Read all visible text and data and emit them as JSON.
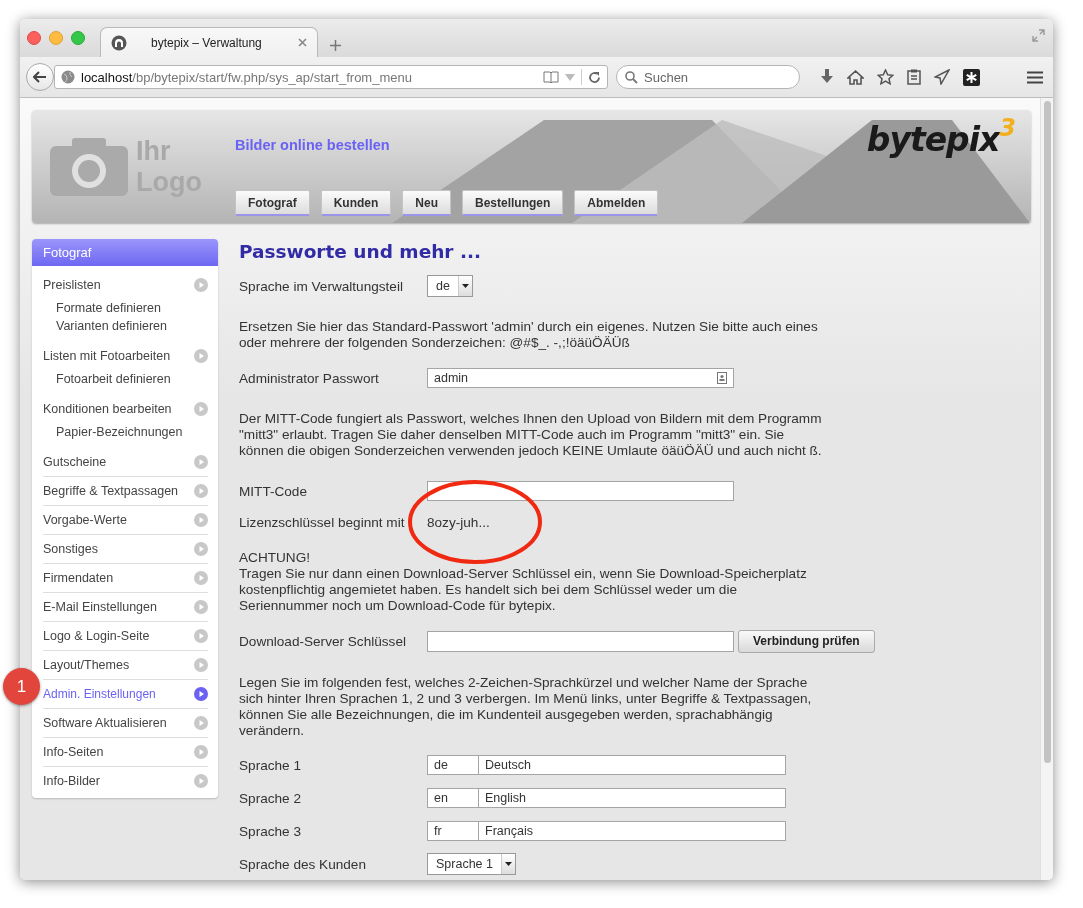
{
  "browser": {
    "tab_title": "bytepix – Verwaltung",
    "url": {
      "host": "localhost",
      "path": "/bp/bytepix/start/fw.php/sys_ap/start_from_menu"
    },
    "search": {
      "placeholder": "Suchen"
    }
  },
  "header": {
    "logo_placeholder": [
      "Ihr",
      "Logo"
    ],
    "tagline": "Bilder online bestellen",
    "nav": [
      "Fotograf",
      "Kunden",
      "Neu",
      "Bestellungen",
      "Abmelden"
    ],
    "brand": {
      "name": "bytepix",
      "version": "3"
    }
  },
  "sidebar": {
    "title": "Fotograf",
    "items": [
      {
        "label": "Preislisten",
        "selected": false,
        "children": [
          "Formate definieren",
          "Varianten definieren"
        ]
      },
      {
        "label": "Listen mit Fotoarbeiten",
        "selected": false,
        "children": [
          "Fotoarbeit definieren"
        ]
      },
      {
        "label": "Konditionen bearbeiten",
        "selected": false,
        "children": [
          "Papier-Bezeichnungen"
        ]
      },
      {
        "label": "Gutscheine",
        "selected": false
      },
      {
        "label": "Begriffe & Textpassagen",
        "selected": false
      },
      {
        "label": "Vorgabe-Werte",
        "selected": false
      },
      {
        "label": "Sonstiges",
        "selected": false
      },
      {
        "label": "Firmendaten",
        "selected": false
      },
      {
        "label": "E-Mail Einstellungen",
        "selected": false
      },
      {
        "label": "Logo & Login-Seite",
        "selected": false
      },
      {
        "label": "Layout/Themes",
        "selected": false
      },
      {
        "label": "Admin. Einstellungen",
        "selected": true
      },
      {
        "label": "Software Aktualisieren",
        "selected": false
      },
      {
        "label": "Info-Seiten",
        "selected": false
      },
      {
        "label": "Info-Bilder",
        "selected": false
      }
    ]
  },
  "annotation": {
    "label": "1"
  },
  "content": {
    "title": "Passworte und mehr ...",
    "rows": [
      {
        "kind": "select",
        "label": "Sprache im Verwaltungsteil",
        "value": "de"
      },
      {
        "kind": "paragraph",
        "text": "Ersetzen Sie hier das Standard-Passwort 'admin' durch ein eigenes. Nutzen Sie bitte auch eines oder mehrere der folgenden Sonderzeichen: @#$_. -,;!öäüÖÄÜß"
      },
      {
        "kind": "password",
        "label": "Administrator Passwort",
        "value": "admin"
      },
      {
        "kind": "paragraph",
        "text": "Der MITT-Code fungiert als Passwort, welches Ihnen den Upload von Bildern mit dem Programm \"mitt3\" erlaubt. Tragen Sie daher denselben MITT-Code auch im Programm \"mitt3\" ein. Sie können die obigen Sonderzeichen verwenden jedoch KEINE Umlaute öäüÖÄÜ und auch nicht ß."
      },
      {
        "kind": "text",
        "label": "MITT-Code"
      },
      {
        "kind": "static",
        "label": "Lizenzschlüssel beginnt mit",
        "value": "8ozy-juh...",
        "circled": true
      },
      {
        "kind": "notice",
        "title": "ACHTUNG!",
        "text": "Tragen Sie nur dann einen Download-Server Schlüssel ein, wenn Sie Download-Speicherplatz kostenpflichtig angemietet haben. Es handelt sich bei dem Schlüssel weder um die Seriennummer noch um Download-Code für bytepix."
      },
      {
        "kind": "field_button",
        "label": "Download-Server Schlüssel",
        "button": "Verbindung prüfen"
      },
      {
        "kind": "paragraph",
        "text": "Legen Sie im folgenden fest, welches 2-Zeichen-Sprachkürzel und welcher Name der Sprache sich hinter Ihren Sprachen 1, 2 und 3 verbergen. Im Menü links, unter Begriffe & Textpassagen, können Sie alle Bezeichnungen, die im Kundenteil ausgegeben werden, sprachabhängig verändern."
      },
      {
        "kind": "language",
        "label": "Sprache 1",
        "code": "de",
        "name": "Deutsch"
      },
      {
        "kind": "language",
        "label": "Sprache 2",
        "code": "en",
        "name": "English"
      },
      {
        "kind": "language",
        "label": "Sprache 3",
        "code": "fr",
        "name": "Français"
      },
      {
        "kind": "select",
        "label": "Sprache des Kunden",
        "value": "Sprache 1"
      }
    ]
  }
}
